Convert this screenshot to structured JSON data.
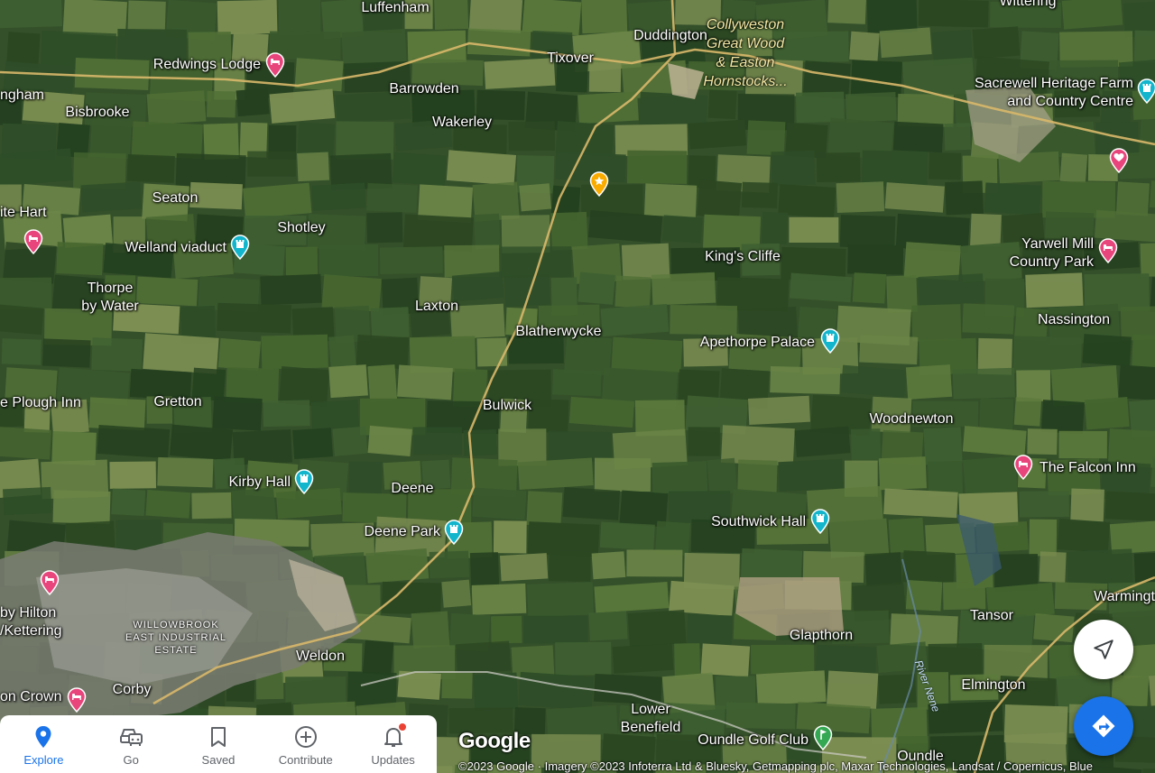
{
  "map": {
    "places": [
      {
        "id": "luffenham",
        "name": "Luffenham"
      },
      {
        "id": "duddington",
        "name": "Duddington"
      },
      {
        "id": "tixover",
        "name": "Tixover"
      },
      {
        "id": "barrowden",
        "name": "Barrowden"
      },
      {
        "id": "wakerley",
        "name": "Wakerley"
      },
      {
        "id": "ngham",
        "name": "ngham"
      },
      {
        "id": "bisbrooke",
        "name": "Bisbrooke"
      },
      {
        "id": "seaton",
        "name": "Seaton"
      },
      {
        "id": "shotley",
        "name": "Shotley"
      },
      {
        "id": "thorpe",
        "name": "Thorpe\nby Water"
      },
      {
        "id": "laxton",
        "name": "Laxton"
      },
      {
        "id": "blatherwycke",
        "name": "Blatherwycke"
      },
      {
        "id": "kings_cliffe",
        "name": "King's Cliffe"
      },
      {
        "id": "nassington",
        "name": "Nassington"
      },
      {
        "id": "gretton",
        "name": "Gretton"
      },
      {
        "id": "bulwick",
        "name": "Bulwick"
      },
      {
        "id": "woodnewton",
        "name": "Woodnewton"
      },
      {
        "id": "deene",
        "name": "Deene"
      },
      {
        "id": "weldon",
        "name": "Weldon"
      },
      {
        "id": "corby",
        "name": "Corby"
      },
      {
        "id": "glapthorn",
        "name": "Glapthorn"
      },
      {
        "id": "tansor",
        "name": "Tansor"
      },
      {
        "id": "elmington",
        "name": "Elmington"
      },
      {
        "id": "warmingt",
        "name": "Warmingt"
      },
      {
        "id": "lower_benefield",
        "name": "Lower\nBenefield"
      },
      {
        "id": "oundle",
        "name": "Oundle"
      },
      {
        "id": "wittering",
        "name": "Wittering"
      }
    ],
    "wood_label": "Collyweston\nGreat Wood\n& Easton\nHornstocks...",
    "estate_label": "WILLOWBROOK\nEAST INDUSTRIAL\nESTATE",
    "river_label": "River Nene",
    "pois": [
      {
        "id": "redwings",
        "name": "Redwings Lodge",
        "type": "hotel"
      },
      {
        "id": "white_hart",
        "name": "ite Hart",
        "type": "hotel"
      },
      {
        "id": "welland",
        "name": "Welland viaduct",
        "type": "landmark"
      },
      {
        "id": "plough",
        "name": "e Plough Inn",
        "type": "hotel"
      },
      {
        "id": "kirby",
        "name": "Kirby Hall",
        "type": "landmark"
      },
      {
        "id": "deene_park",
        "name": "Deene Park",
        "type": "landmark"
      },
      {
        "id": "hilton",
        "name": "by Hilton\n/Kettering",
        "type": "hotel"
      },
      {
        "id": "crown",
        "name": "on Crown",
        "type": "hotel"
      },
      {
        "id": "apethorpe",
        "name": "Apethorpe Palace",
        "type": "landmark"
      },
      {
        "id": "southwick",
        "name": "Southwick Hall",
        "type": "landmark"
      },
      {
        "id": "falcon",
        "name": "The Falcon Inn",
        "type": "hotel"
      },
      {
        "id": "yarwell",
        "name": "Yarwell Mill\nCountry Park",
        "type": "hotel"
      },
      {
        "id": "sacrewell",
        "name": "Sacrewell Heritage Farm\nand Country Centre",
        "type": "landmark"
      },
      {
        "id": "saved_star",
        "name": "",
        "type": "saved"
      },
      {
        "id": "heart",
        "name": "",
        "type": "favorite"
      },
      {
        "id": "oundle_golf",
        "name": "Oundle Golf Club",
        "type": "golf"
      }
    ],
    "logo": "Google",
    "attribution": "©2023 Google · Imagery ©2023 Infoterra Ltd & Bluesky, Getmapping plc, Maxar Technologies, Landsat / Copernicus, Blue"
  },
  "nav": {
    "items": [
      {
        "label": "Explore",
        "icon": "location-pin-icon",
        "active": true
      },
      {
        "label": "Go",
        "icon": "car-icon",
        "active": false
      },
      {
        "label": "Saved",
        "icon": "bookmark-icon",
        "active": false
      },
      {
        "label": "Contribute",
        "icon": "add-circle-icon",
        "active": false
      },
      {
        "label": "Updates",
        "icon": "bell-icon",
        "active": false,
        "badge": true
      }
    ]
  },
  "colors": {
    "accent": "#1a73e8",
    "hotel_pin": "#e8457c",
    "landmark_pin": "#12b5cb",
    "saved_pin": "#f9ab00",
    "golf_pin": "#34a853"
  }
}
